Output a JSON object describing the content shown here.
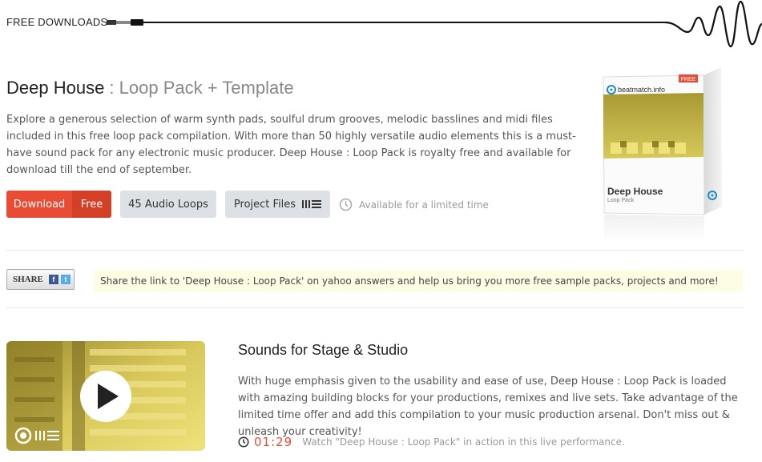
{
  "header": {
    "label": "FREE DOWNLOADS"
  },
  "product": {
    "title_main": "Deep House",
    "title_sep": " : ",
    "title_sub": "Loop Pack + Template",
    "description": "Explore a generous selection of warm synth pads, soulful drum grooves, melodic basslines and midi files included in this free loop pack compilation. With more than 50 highly versatile audio elements this is a must-have sound pack for any electronic music producer. Deep House : Loop Pack is royalty free and available for download till the end of september."
  },
  "actions": {
    "download_label": "Download",
    "download_free": "Free",
    "loops_label": "45 Audio Loops",
    "project_label": "Project Files",
    "availability": "Available for a limited time"
  },
  "box": {
    "brand": "beatmatch.info",
    "badge": "FREE",
    "name": "Deep House",
    "subname": "Loop Pack"
  },
  "share": {
    "button_label": "SHARE",
    "note": "Share the link to 'Deep House : Loop Pack' on yahoo answers and help us bring you more free sample packs, projects and more!"
  },
  "section": {
    "title": "Sounds for Stage & Studio",
    "description": "With huge emphasis given to the usability and ease of use, Deep House : Loop Pack is loaded with amazing building blocks for your productions, remixes and live sets. Take advantage of the limited time offer and add this compilation to your music production arsenal. Don't miss out & unleash your creativity!",
    "duration": "01:29",
    "watch_text": "Watch \"Deep House : Loop Pack\" in action in this live performance."
  },
  "colors": {
    "accent": "#e94c34",
    "accent_dark": "#d43f28",
    "button_gray": "#dde1e5",
    "note_bg": "#fdfde4"
  },
  "icons": [
    "audio-cable-icon",
    "waveform-icon",
    "clock-icon",
    "bars-icon",
    "facebook-icon",
    "twitter-icon",
    "play-icon",
    "record-icon",
    "beatmatch-logo-icon"
  ]
}
